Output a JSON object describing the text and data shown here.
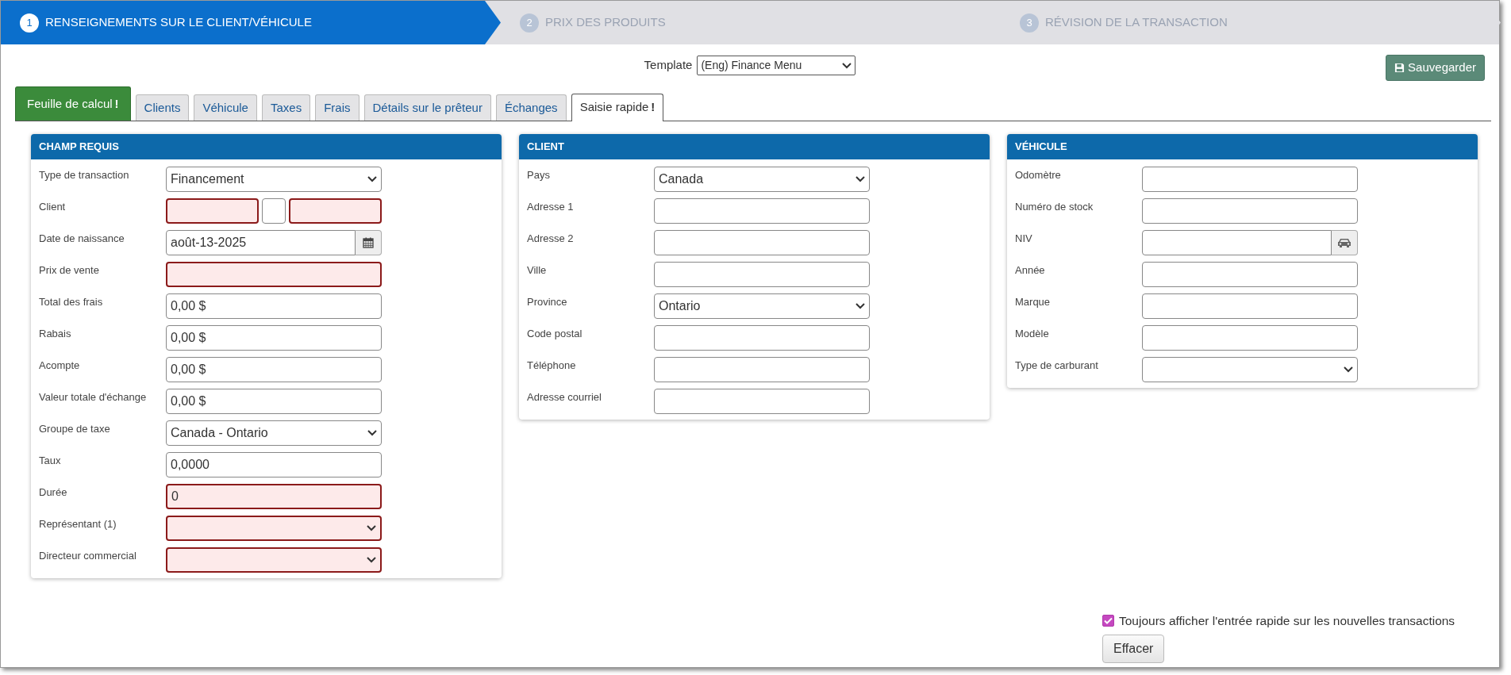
{
  "steps": [
    {
      "number": "1",
      "label": "RENSEIGNEMENTS SUR LE CLIENT/VÉHICULE",
      "selected": true
    },
    {
      "number": "2",
      "label": "PRIX DES PRODUITS",
      "selected": false
    },
    {
      "number": "3",
      "label": "RÉVISION DE LA TRANSACTION",
      "selected": false
    }
  ],
  "template": {
    "label": "Template",
    "value": "(Eng) Finance Menu"
  },
  "save_button": "Sauvegarder",
  "tabs": [
    {
      "kind": "action",
      "label": "Feuille de calcul",
      "mark": "!",
      "selected": false
    },
    {
      "kind": "tab",
      "label": "Clients",
      "selected": false
    },
    {
      "kind": "tab",
      "label": "Véhicule",
      "selected": false
    },
    {
      "kind": "tab",
      "label": "Taxes",
      "selected": false
    },
    {
      "kind": "tab",
      "label": "Frais",
      "selected": false
    },
    {
      "kind": "tab",
      "label": "Détails sur le prêteur",
      "selected": false
    },
    {
      "kind": "tab",
      "label": "Échanges",
      "selected": false
    },
    {
      "kind": "tab",
      "label": "Saisie rapide",
      "mark": "!",
      "selected": true
    }
  ],
  "panels": [
    {
      "title": "CHAMP REQUIS",
      "fields": [
        {
          "label": "Type de transaction",
          "kind": "select",
          "value": "Financement",
          "required": false
        },
        {
          "label": "Client",
          "kind": "split",
          "parts": [
            {
              "required": true
            },
            {
              "required": false
            },
            {
              "required": true
            }
          ]
        },
        {
          "label": "Date de naissance",
          "kind": "date",
          "value": "août-13-2025",
          "required": false
        },
        {
          "label": "Prix de vente",
          "kind": "input",
          "required": true
        },
        {
          "label": "Total des frais",
          "kind": "input",
          "value": "0,00 $",
          "required": false
        },
        {
          "label": "Rabais",
          "kind": "input",
          "value": "0,00 $",
          "required": false
        },
        {
          "label": "Acompte",
          "kind": "input",
          "value": "0,00 $",
          "required": false
        },
        {
          "label": "Valeur totale d'échange",
          "kind": "input",
          "value": "0,00 $",
          "required": false
        },
        {
          "label": "Groupe de taxe",
          "kind": "select",
          "value": "Canada - Ontario",
          "required": false
        },
        {
          "label": "Taux",
          "kind": "input",
          "value": "0,0000",
          "required": false
        },
        {
          "label": "Durée",
          "kind": "input",
          "value": "0",
          "required": true
        },
        {
          "label": "Représentant (1)",
          "kind": "select",
          "required": true
        },
        {
          "label": "Directeur commercial",
          "kind": "select",
          "required": true
        }
      ]
    },
    {
      "title": "CLIENT",
      "fields": [
        {
          "label": "Pays",
          "kind": "select",
          "value": "Canada",
          "required": false
        },
        {
          "label": "Adresse 1",
          "kind": "input",
          "required": false
        },
        {
          "label": "Adresse 2",
          "kind": "input",
          "required": false
        },
        {
          "label": "Ville",
          "kind": "input",
          "required": false
        },
        {
          "label": "Province",
          "kind": "select",
          "value": "Ontario",
          "required": false
        },
        {
          "label": "Code postal",
          "kind": "input",
          "required": false
        },
        {
          "label": "Téléphone",
          "kind": "input",
          "required": false
        },
        {
          "label": "Adresse courriel",
          "kind": "input",
          "required": false
        }
      ]
    },
    {
      "title": "VÉHICULE",
      "fields": [
        {
          "label": "Odomètre",
          "kind": "input",
          "required": false
        },
        {
          "label": "Numéro de stock",
          "kind": "input",
          "required": false
        },
        {
          "label": "NIV",
          "kind": "vin",
          "required": false
        },
        {
          "label": "Année",
          "kind": "input",
          "required": false
        },
        {
          "label": "Marque",
          "kind": "input",
          "required": false
        },
        {
          "label": "Modèle",
          "kind": "input",
          "required": false
        },
        {
          "label": "Type de carburant",
          "kind": "select",
          "required": false
        }
      ]
    }
  ],
  "always_show": {
    "label": "Toujours afficher l'entrée rapide sur les nouvelles transactions",
    "checked": true
  },
  "clear_button": "Effacer"
}
